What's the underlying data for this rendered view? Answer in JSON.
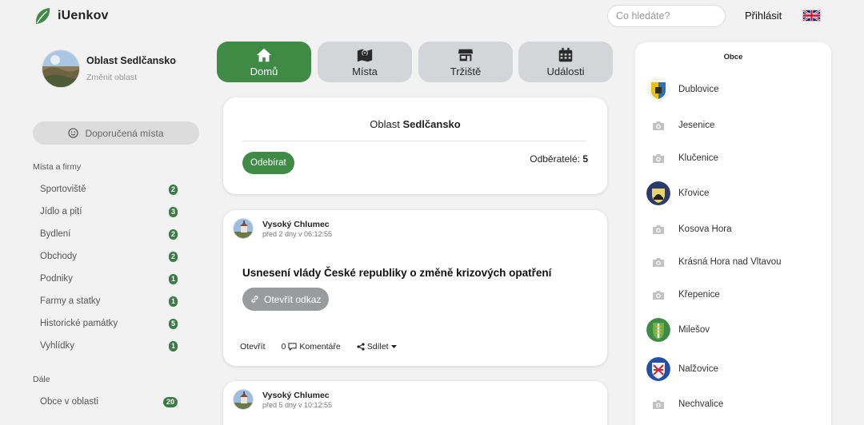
{
  "header": {
    "logo_text": "iUenkov",
    "search_placeholder": "Co hledáte?",
    "login_label": "Přihlásit"
  },
  "region": {
    "name": "Oblast Sedlčansko",
    "change_label": "Změnit oblast"
  },
  "sidebar": {
    "recommended_label": "Doporučená místa",
    "section1_title": "Místa a firmy",
    "categories": [
      {
        "label": "Sportoviště",
        "count": "2"
      },
      {
        "label": "Jídlo a pití",
        "count": "3"
      },
      {
        "label": "Bydlení",
        "count": "2"
      },
      {
        "label": "Obchody",
        "count": "2"
      },
      {
        "label": "Podniky",
        "count": "1"
      },
      {
        "label": "Farmy a statky",
        "count": "1"
      },
      {
        "label": "Historické památky",
        "count": "5"
      },
      {
        "label": "Vyhlídky",
        "count": "1"
      }
    ],
    "section2_title": "Dále",
    "more": [
      {
        "label": "Obce v oblasti",
        "count": "20"
      }
    ]
  },
  "tabs": [
    {
      "label": "Domů",
      "icon": "home-icon"
    },
    {
      "label": "Místa",
      "icon": "map-icon"
    },
    {
      "label": "Tržiště",
      "icon": "store-icon"
    },
    {
      "label": "Události",
      "icon": "calendar-icon"
    }
  ],
  "region_card": {
    "title_prefix": "Oblast",
    "title_bold": "Sedlčansko",
    "subscribe_label": "Odebírat",
    "subscribers_label": "Odběratelé:",
    "subscribers_count": "5"
  },
  "posts": [
    {
      "author": "Vysoký Chlumec",
      "time": "před 2 dny v 06:12:55",
      "title": "Usnesení vlády České republiky o změně krizových opatření",
      "link_label": "Otevřít odkaz",
      "open_label": "Otevřít",
      "comments_count": "0",
      "comments_label": "Komentáře",
      "share_label": "Sdílet"
    },
    {
      "author": "Vysoký Chlumec",
      "time": "před 5 dny v 10:12:55"
    }
  ],
  "obce": {
    "title": "Obce",
    "items": [
      {
        "name": "Dublovice",
        "icon": "dublovice-crest-icon"
      },
      {
        "name": "Jesenice",
        "icon": "camera-icon"
      },
      {
        "name": "Klučenice",
        "icon": "camera-icon"
      },
      {
        "name": "Křovice",
        "icon": "krovice-crest-icon"
      },
      {
        "name": "Kosova Hora",
        "icon": "camera-icon"
      },
      {
        "name": "Krásná Hora nad Vltavou",
        "icon": "camera-icon"
      },
      {
        "name": "Křepenice",
        "icon": "camera-icon"
      },
      {
        "name": "Milešov",
        "icon": "milesov-crest-icon"
      },
      {
        "name": "Nalžovice",
        "icon": "nalzovice-crest-icon"
      },
      {
        "name": "Nechvalice",
        "icon": "camera-icon"
      }
    ]
  },
  "colors": {
    "primary_green": "#3f8b46",
    "badge_green": "#3a7a44",
    "tab_inactive": "#d3d5d8",
    "background": "#f2f2f2"
  }
}
